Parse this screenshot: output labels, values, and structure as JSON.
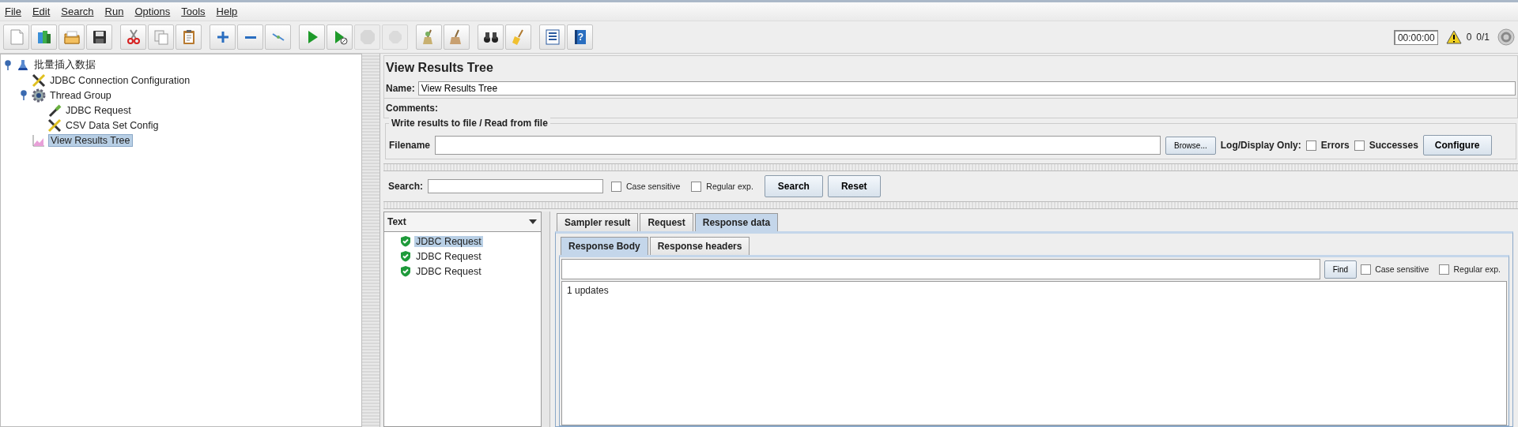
{
  "menu": [
    "File",
    "Edit",
    "Search",
    "Run",
    "Options",
    "Tools",
    "Help"
  ],
  "toolbar": [
    {
      "kind": "new",
      "disabled": false
    },
    {
      "kind": "templates",
      "disabled": false
    },
    {
      "kind": "open",
      "disabled": false
    },
    {
      "kind": "save",
      "disabled": false
    },
    {
      "kind": "cut",
      "disabled": false
    },
    {
      "kind": "copy",
      "disabled": false
    },
    {
      "kind": "paste",
      "disabled": false
    },
    {
      "kind": "add",
      "disabled": false
    },
    {
      "kind": "remove",
      "disabled": false
    },
    {
      "kind": "toggle",
      "disabled": false
    },
    {
      "kind": "start",
      "disabled": false
    },
    {
      "kind": "start-no-pause",
      "disabled": false
    },
    {
      "kind": "stop",
      "disabled": true
    },
    {
      "kind": "shutdown",
      "disabled": true
    },
    {
      "kind": "clear",
      "disabled": false
    },
    {
      "kind": "clear-all",
      "disabled": false
    },
    {
      "kind": "search",
      "disabled": false
    },
    {
      "kind": "reset-search",
      "disabled": false
    },
    {
      "kind": "function-helper",
      "disabled": false
    },
    {
      "kind": "help",
      "disabled": false,
      "glyph": "?"
    }
  ],
  "status": {
    "timer": "00:00:00",
    "warnings": "0",
    "threads": "0/1"
  },
  "tree": [
    {
      "label": "批量插入数据",
      "kind": "testplan",
      "selected": false,
      "expanded": true,
      "children": [
        {
          "label": "JDBC Connection Configuration",
          "kind": "config",
          "selected": false
        },
        {
          "label": "Thread Group",
          "kind": "threadgroup",
          "selected": false,
          "expanded": true,
          "children": [
            {
              "label": "JDBC Request",
              "kind": "sampler",
              "selected": false
            },
            {
              "label": "CSV Data Set Config",
              "kind": "config",
              "selected": false
            }
          ]
        },
        {
          "label": "View Results Tree",
          "kind": "listener",
          "selected": true
        }
      ]
    }
  ],
  "panel": {
    "title": "View Results Tree",
    "name_label": "Name:",
    "name_value": "View Results Tree",
    "comments_label": "Comments:",
    "file_group": "Write results to file / Read from file",
    "filename_label": "Filename",
    "browse": "Browse...",
    "log_label": "Log/Display Only:",
    "errors": {
      "label": "Errors",
      "checked": false
    },
    "successes": {
      "label": "Successes",
      "checked": false
    },
    "configure": "Configure"
  },
  "search": {
    "label": "Search:",
    "case_sensitive": {
      "label": "Case sensitive",
      "checked": false
    },
    "regex": {
      "label": "Regular exp.",
      "checked": false
    },
    "search_button": "Search",
    "reset_button": "Reset"
  },
  "renderer": "Text",
  "results": [
    {
      "label": "JDBC Request",
      "selected": true
    },
    {
      "label": "JDBC Request",
      "selected": false
    },
    {
      "label": "JDBC Request",
      "selected": false
    }
  ],
  "tabs": [
    {
      "label": "Sampler result",
      "selected": false
    },
    {
      "label": "Request",
      "selected": false
    },
    {
      "label": "Response data",
      "selected": true
    }
  ],
  "subtabs": [
    {
      "label": "Response Body",
      "selected": true
    },
    {
      "label": "Response headers",
      "selected": false
    }
  ],
  "find": {
    "button": "Find",
    "case_sensitive": {
      "label": "Case sensitive",
      "checked": false
    },
    "regex": {
      "label": "Regular exp.",
      "checked": false
    }
  },
  "body": "1 updates"
}
